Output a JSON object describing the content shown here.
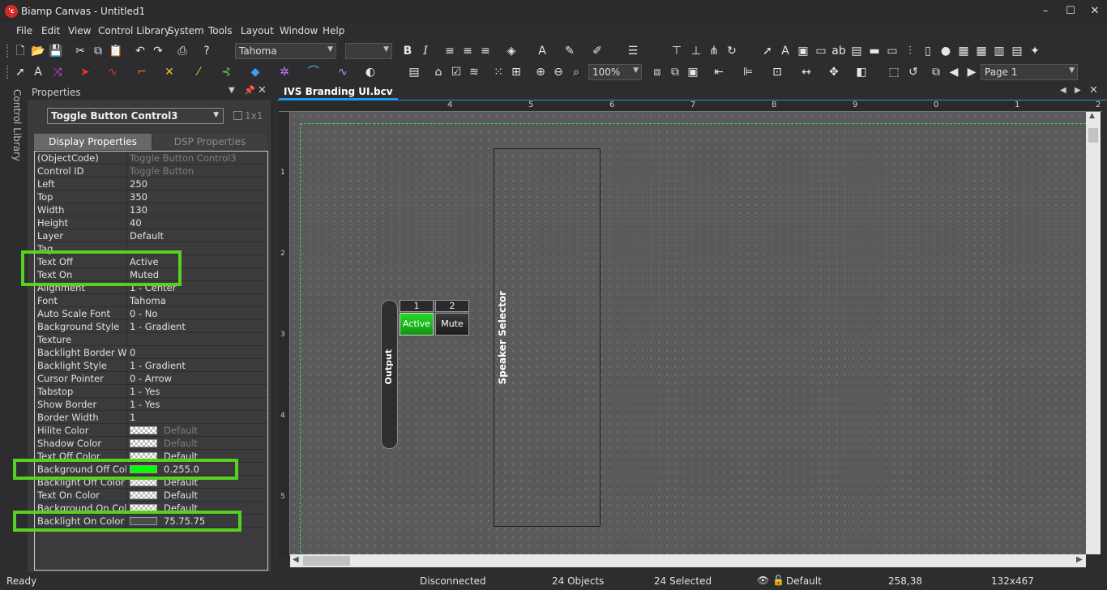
{
  "window": {
    "title": "Biamp Canvas - Untitled1",
    "app_icon": "'c",
    "min": "–",
    "max": "☐",
    "close": "✕"
  },
  "menu": [
    "File",
    "Edit",
    "View",
    "Control Library",
    "System",
    "Tools",
    "Layout",
    "Window",
    "Help"
  ],
  "toolbar": {
    "font": "Tahoma",
    "zoom": "100%",
    "page": "Page 1"
  },
  "left_strip": {
    "tab": "Control Library"
  },
  "properties": {
    "title": "Properties",
    "object": "Toggle Button Control3",
    "grid_label": "1x1",
    "tabs": [
      "Display Properties",
      "DSP Properties"
    ],
    "rows": [
      {
        "name": "(ObjectCode)",
        "value": "Toggle Button Control3",
        "dim": true
      },
      {
        "name": "Control ID",
        "value": "Toggle Button",
        "dim": true
      },
      {
        "name": "Left",
        "value": "250"
      },
      {
        "name": "Top",
        "value": "350"
      },
      {
        "name": "Width",
        "value": "130"
      },
      {
        "name": "Height",
        "value": "40"
      },
      {
        "name": "Layer",
        "value": "Default"
      },
      {
        "name": "Tag",
        "value": ""
      },
      {
        "name": "Text Off",
        "value": "Active"
      },
      {
        "name": "Text On",
        "value": "Muted"
      },
      {
        "name": "Alignment",
        "value": "1 - Center"
      },
      {
        "name": "Font",
        "value": "Tahoma"
      },
      {
        "name": "Auto Scale Font",
        "value": "0 - No"
      },
      {
        "name": "Background Style",
        "value": "1 - Gradient"
      },
      {
        "name": "Texture",
        "value": ""
      },
      {
        "name": "Backlight Border Width",
        "value": "0"
      },
      {
        "name": "Backlight Style",
        "value": "1 - Gradient"
      },
      {
        "name": "Cursor Pointer",
        "value": "0 - Arrow"
      },
      {
        "name": "Tabstop",
        "value": "1 - Yes"
      },
      {
        "name": "Show Border",
        "value": "1 - Yes"
      },
      {
        "name": "Border Width",
        "value": "1"
      },
      {
        "name": "Hilite Color",
        "value": "Default",
        "swatch": "check",
        "dim": true
      },
      {
        "name": "Shadow Color",
        "value": "Default",
        "swatch": "check",
        "dim": true
      },
      {
        "name": "Text Off Color",
        "value": "Default",
        "swatch": "check"
      },
      {
        "name": "Background Off Color",
        "value": "0.255.0",
        "swatch": "#00ff00"
      },
      {
        "name": "Backlight Off Color",
        "value": "Default",
        "swatch": "check"
      },
      {
        "name": "Text On Color",
        "value": "Default",
        "swatch": "check"
      },
      {
        "name": "Background On Color",
        "value": "Default",
        "swatch": "check"
      },
      {
        "name": "Backlight On Color",
        "value": "75.75.75",
        "swatch": "#4b4b4b"
      }
    ]
  },
  "document": {
    "tab": "IVS Branding UI.bcv",
    "ruler_top": [
      "4",
      "5",
      "6",
      "7",
      "8",
      "9",
      "0",
      "1",
      "2"
    ],
    "ruler_left": [
      "1",
      "2",
      "3",
      "4",
      "5"
    ],
    "output_label": "Output",
    "buttons": [
      {
        "num": "1",
        "label": "Active",
        "color": "#19c019"
      },
      {
        "num": "2",
        "label": "Mute",
        "color": "#2a2a2a"
      }
    ],
    "selector_label": "Speaker Selector"
  },
  "status": {
    "ready": "Ready",
    "connection": "Disconnected",
    "objects": "24 Objects",
    "selected": "24 Selected",
    "layer": "Default",
    "coords": "258,38",
    "size": "132x467"
  }
}
